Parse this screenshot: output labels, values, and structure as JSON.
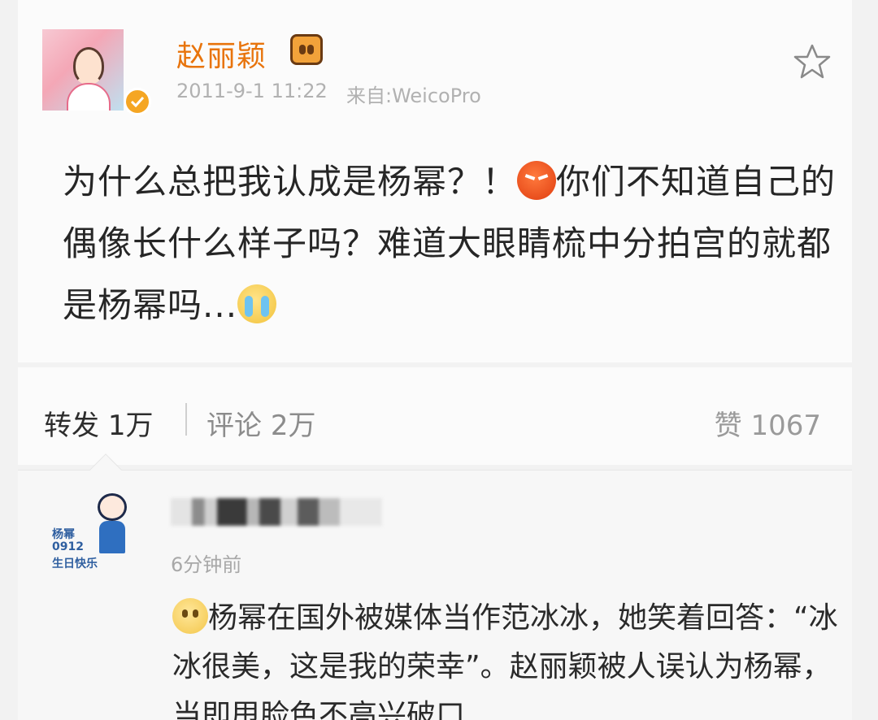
{
  "post": {
    "author": "赵丽颖",
    "timestamp": "2011-9-1 11:22",
    "source": "来自:WeicoPro",
    "text_part1": "为什么总把我认成是杨幂？！",
    "text_part2": "你们不知道自己的偶像长什么样子吗？难道大眼睛梳中分拍宫的就都是杨幂吗...",
    "icons": [
      "verified-badge-icon",
      "member-crown-icon",
      "star-icon",
      "angry-emoji-icon",
      "crying-emoji-icon"
    ]
  },
  "actions": {
    "repost_label": "转发",
    "repost_count": "1万",
    "comment_label": "评论",
    "comment_count": "2万",
    "like_label": "赞",
    "like_count": "1067"
  },
  "comment": {
    "avatar_tag_1": "杨幂",
    "avatar_tag_2": "0912",
    "avatar_tag_3": "生日快乐",
    "time": "6分钟前",
    "text": "杨幂在国外被媒体当作范冰冰，她笑着回答：“冰冰很美，这是我的荣幸”。赵丽颖被人误认为杨幂，当即甩脸色不高兴破口"
  },
  "colors": {
    "username": "#e8740c",
    "meta": "#b1b1b1",
    "background": "#f2f2f2",
    "card": "#fbfbfb"
  }
}
